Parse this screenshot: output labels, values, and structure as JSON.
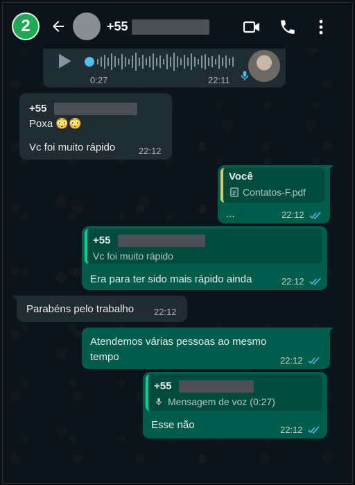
{
  "header": {
    "badge": "2",
    "contact_prefix": "+55"
  },
  "voice_note": {
    "duration": "0:27",
    "time": "22:11"
  },
  "messages": [
    {
      "sender": "+55",
      "lines": [
        "Poxa 😳😳",
        "Vc foi muito rápido"
      ],
      "time": "22:12"
    },
    {
      "quote_author": "Você",
      "quote_file": "Contatos-F.pdf",
      "text": "...",
      "time": "22:12"
    },
    {
      "quote_author": "+55",
      "quote_text": "Vc foi muito rápido",
      "text": "Era para ter sido mais rápido ainda",
      "time": "22:12"
    },
    {
      "text": "Parabéns pelo trabalho",
      "time": "22:12"
    },
    {
      "text_line1": "Atendemos várias pessoas ao mesmo",
      "text_line2": "tempo",
      "time": "22:12"
    },
    {
      "quote_author": "+55",
      "quote_text": "Mensagem de voz (0:27)",
      "text": "Esse não",
      "time": "22:12"
    }
  ],
  "colors": {
    "incoming": "#202c33",
    "outgoing": "#005c4b",
    "read_ticks": "#53bdeb",
    "badge": "#1fa855"
  }
}
